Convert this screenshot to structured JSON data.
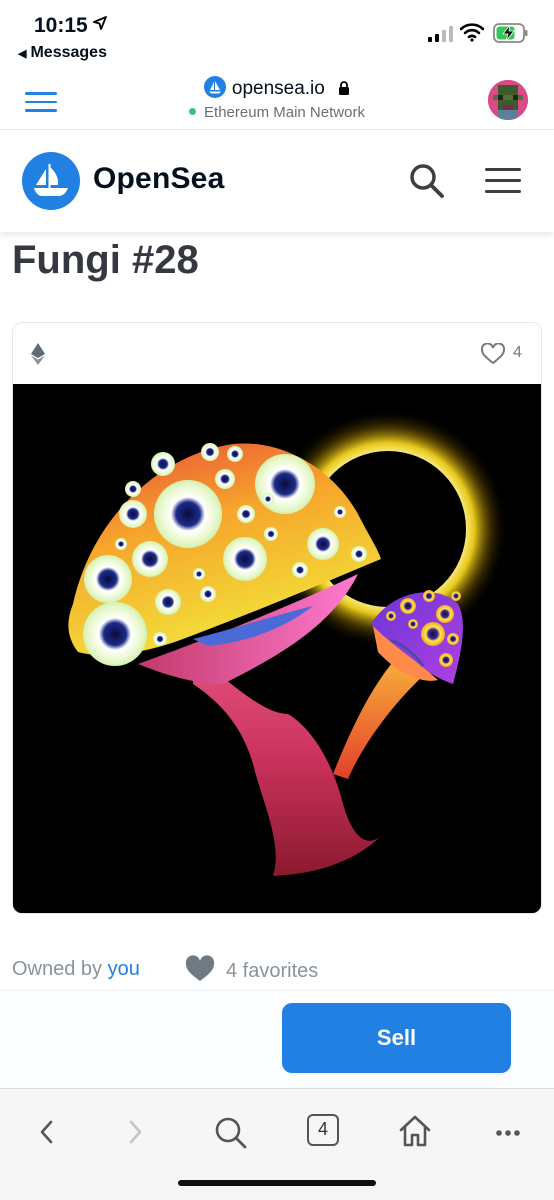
{
  "status_bar": {
    "time": "10:15",
    "back_app": "Messages"
  },
  "browser": {
    "domain": "opensea.io",
    "network": "Ethereum Main Network"
  },
  "site_header": {
    "brand": "OpenSea"
  },
  "item": {
    "title": "Fungi #28",
    "favorite_count": "4",
    "owned_by_label": "Owned by",
    "owner": "you",
    "favorites_text": "4 favorites"
  },
  "actions": {
    "sell_label": "Sell"
  },
  "safari_toolbar": {
    "tab_count": "4"
  },
  "colors": {
    "brand_blue": "#2081e2",
    "title_text": "#353840"
  }
}
